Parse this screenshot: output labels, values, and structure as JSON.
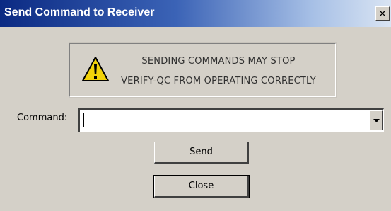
{
  "window": {
    "title": "Send Command to Receiver",
    "close_glyph": "×"
  },
  "warning": {
    "icon": "warning-icon",
    "line1": "SENDING COMMANDS MAY STOP",
    "line2": "VERIFY-QC FROM OPERATING CORRECTLY"
  },
  "command": {
    "label": "Command:",
    "value": "",
    "dropdown_icon": "chevron-down-icon"
  },
  "buttons": {
    "send_label": "Send",
    "close_label": "Close"
  },
  "colors": {
    "titlebar_start": "#0b2a83",
    "titlebar_end": "#d9e4f3",
    "dialog_bg": "#d4d0c8",
    "warning_yellow": "#f2d20a"
  }
}
